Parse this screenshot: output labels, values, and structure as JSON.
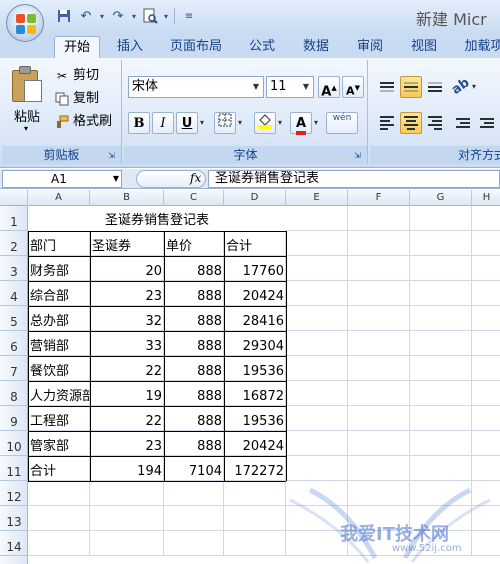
{
  "window": {
    "title": "新建 Micr"
  },
  "tabs": [
    "开始",
    "插入",
    "页面布局",
    "公式",
    "数据",
    "审阅",
    "视图",
    "加载项"
  ],
  "clipboard": {
    "paste": "粘贴",
    "cut": "剪切",
    "copy": "复制",
    "format_painter": "格式刷",
    "group_label": "剪贴板"
  },
  "font": {
    "name": "宋体",
    "size": "11",
    "bold": "B",
    "italic": "I",
    "underline": "U",
    "phonetic": "wén",
    "group_label": "字体"
  },
  "alignment": {
    "group_label": "对齐方式"
  },
  "formula_bar": {
    "cell_ref": "A1",
    "fx": "fx",
    "formula": "圣诞券销售登记表"
  },
  "sheet": {
    "columns": [
      "A",
      "B",
      "C",
      "D",
      "E",
      "F",
      "G",
      "H"
    ],
    "rows": [
      "1",
      "2",
      "3",
      "4",
      "5",
      "6",
      "7",
      "8",
      "9",
      "10",
      "11",
      "12",
      "13",
      "14"
    ],
    "table_title": "圣诞券销售登记表",
    "headers": [
      "部门",
      "圣诞券",
      "单价",
      "合计"
    ],
    "data": [
      [
        "财务部",
        "20",
        "888",
        "17760"
      ],
      [
        "综合部",
        "23",
        "888",
        "20424"
      ],
      [
        "总办部",
        "32",
        "888",
        "28416"
      ],
      [
        "营销部",
        "33",
        "888",
        "29304"
      ],
      [
        "餐饮部",
        "22",
        "888",
        "19536"
      ],
      [
        "人力资源部",
        "19",
        "888",
        "16872"
      ],
      [
        "工程部",
        "22",
        "888",
        "19536"
      ],
      [
        "管家部",
        "23",
        "888",
        "20424"
      ]
    ],
    "total": [
      "合计",
      "194",
      "7104",
      "172272"
    ]
  },
  "watermark": {
    "text": "我爱IT技术网",
    "url": "www.52ij.com"
  }
}
